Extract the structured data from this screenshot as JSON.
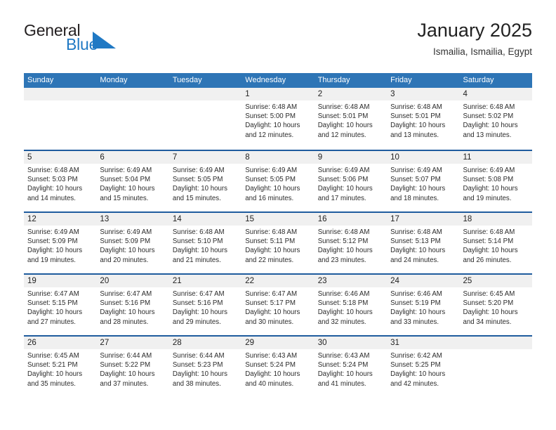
{
  "brand": {
    "name_part1": "General",
    "name_part2": "Blue",
    "triangle_icon": "blue-triangle-icon",
    "color_dark": "#231f20",
    "color_blue": "#2079c4"
  },
  "header": {
    "title": "January 2025",
    "subtitle": "Ismailia, Ismailia, Egypt"
  },
  "theme": {
    "header_row_bg": "#2e75b6",
    "week_separator": "#1f5c9e",
    "day_number_bg": "#f0f0f0",
    "text": "#2b2b2b"
  },
  "weekdays": [
    "Sunday",
    "Monday",
    "Tuesday",
    "Wednesday",
    "Thursday",
    "Friday",
    "Saturday"
  ],
  "weeks": [
    [
      {
        "empty": true,
        "day": ""
      },
      {
        "empty": true,
        "day": ""
      },
      {
        "empty": true,
        "day": ""
      },
      {
        "day": "1",
        "sunrise": "Sunrise: 6:48 AM",
        "sunset": "Sunset: 5:00 PM",
        "daylight": "Daylight: 10 hours and 12 minutes."
      },
      {
        "day": "2",
        "sunrise": "Sunrise: 6:48 AM",
        "sunset": "Sunset: 5:01 PM",
        "daylight": "Daylight: 10 hours and 12 minutes."
      },
      {
        "day": "3",
        "sunrise": "Sunrise: 6:48 AM",
        "sunset": "Sunset: 5:01 PM",
        "daylight": "Daylight: 10 hours and 13 minutes."
      },
      {
        "day": "4",
        "sunrise": "Sunrise: 6:48 AM",
        "sunset": "Sunset: 5:02 PM",
        "daylight": "Daylight: 10 hours and 13 minutes."
      }
    ],
    [
      {
        "day": "5",
        "sunrise": "Sunrise: 6:48 AM",
        "sunset": "Sunset: 5:03 PM",
        "daylight": "Daylight: 10 hours and 14 minutes."
      },
      {
        "day": "6",
        "sunrise": "Sunrise: 6:49 AM",
        "sunset": "Sunset: 5:04 PM",
        "daylight": "Daylight: 10 hours and 15 minutes."
      },
      {
        "day": "7",
        "sunrise": "Sunrise: 6:49 AM",
        "sunset": "Sunset: 5:05 PM",
        "daylight": "Daylight: 10 hours and 15 minutes."
      },
      {
        "day": "8",
        "sunrise": "Sunrise: 6:49 AM",
        "sunset": "Sunset: 5:05 PM",
        "daylight": "Daylight: 10 hours and 16 minutes."
      },
      {
        "day": "9",
        "sunrise": "Sunrise: 6:49 AM",
        "sunset": "Sunset: 5:06 PM",
        "daylight": "Daylight: 10 hours and 17 minutes."
      },
      {
        "day": "10",
        "sunrise": "Sunrise: 6:49 AM",
        "sunset": "Sunset: 5:07 PM",
        "daylight": "Daylight: 10 hours and 18 minutes."
      },
      {
        "day": "11",
        "sunrise": "Sunrise: 6:49 AM",
        "sunset": "Sunset: 5:08 PM",
        "daylight": "Daylight: 10 hours and 19 minutes."
      }
    ],
    [
      {
        "day": "12",
        "sunrise": "Sunrise: 6:49 AM",
        "sunset": "Sunset: 5:09 PM",
        "daylight": "Daylight: 10 hours and 19 minutes."
      },
      {
        "day": "13",
        "sunrise": "Sunrise: 6:49 AM",
        "sunset": "Sunset: 5:09 PM",
        "daylight": "Daylight: 10 hours and 20 minutes."
      },
      {
        "day": "14",
        "sunrise": "Sunrise: 6:48 AM",
        "sunset": "Sunset: 5:10 PM",
        "daylight": "Daylight: 10 hours and 21 minutes."
      },
      {
        "day": "15",
        "sunrise": "Sunrise: 6:48 AM",
        "sunset": "Sunset: 5:11 PM",
        "daylight": "Daylight: 10 hours and 22 minutes."
      },
      {
        "day": "16",
        "sunrise": "Sunrise: 6:48 AM",
        "sunset": "Sunset: 5:12 PM",
        "daylight": "Daylight: 10 hours and 23 minutes."
      },
      {
        "day": "17",
        "sunrise": "Sunrise: 6:48 AM",
        "sunset": "Sunset: 5:13 PM",
        "daylight": "Daylight: 10 hours and 24 minutes."
      },
      {
        "day": "18",
        "sunrise": "Sunrise: 6:48 AM",
        "sunset": "Sunset: 5:14 PM",
        "daylight": "Daylight: 10 hours and 26 minutes."
      }
    ],
    [
      {
        "day": "19",
        "sunrise": "Sunrise: 6:47 AM",
        "sunset": "Sunset: 5:15 PM",
        "daylight": "Daylight: 10 hours and 27 minutes."
      },
      {
        "day": "20",
        "sunrise": "Sunrise: 6:47 AM",
        "sunset": "Sunset: 5:16 PM",
        "daylight": "Daylight: 10 hours and 28 minutes."
      },
      {
        "day": "21",
        "sunrise": "Sunrise: 6:47 AM",
        "sunset": "Sunset: 5:16 PM",
        "daylight": "Daylight: 10 hours and 29 minutes."
      },
      {
        "day": "22",
        "sunrise": "Sunrise: 6:47 AM",
        "sunset": "Sunset: 5:17 PM",
        "daylight": "Daylight: 10 hours and 30 minutes."
      },
      {
        "day": "23",
        "sunrise": "Sunrise: 6:46 AM",
        "sunset": "Sunset: 5:18 PM",
        "daylight": "Daylight: 10 hours and 32 minutes."
      },
      {
        "day": "24",
        "sunrise": "Sunrise: 6:46 AM",
        "sunset": "Sunset: 5:19 PM",
        "daylight": "Daylight: 10 hours and 33 minutes."
      },
      {
        "day": "25",
        "sunrise": "Sunrise: 6:45 AM",
        "sunset": "Sunset: 5:20 PM",
        "daylight": "Daylight: 10 hours and 34 minutes."
      }
    ],
    [
      {
        "day": "26",
        "sunrise": "Sunrise: 6:45 AM",
        "sunset": "Sunset: 5:21 PM",
        "daylight": "Daylight: 10 hours and 35 minutes."
      },
      {
        "day": "27",
        "sunrise": "Sunrise: 6:44 AM",
        "sunset": "Sunset: 5:22 PM",
        "daylight": "Daylight: 10 hours and 37 minutes."
      },
      {
        "day": "28",
        "sunrise": "Sunrise: 6:44 AM",
        "sunset": "Sunset: 5:23 PM",
        "daylight": "Daylight: 10 hours and 38 minutes."
      },
      {
        "day": "29",
        "sunrise": "Sunrise: 6:43 AM",
        "sunset": "Sunset: 5:24 PM",
        "daylight": "Daylight: 10 hours and 40 minutes."
      },
      {
        "day": "30",
        "sunrise": "Sunrise: 6:43 AM",
        "sunset": "Sunset: 5:24 PM",
        "daylight": "Daylight: 10 hours and 41 minutes."
      },
      {
        "day": "31",
        "sunrise": "Sunrise: 6:42 AM",
        "sunset": "Sunset: 5:25 PM",
        "daylight": "Daylight: 10 hours and 42 minutes."
      },
      {
        "empty": true,
        "day": ""
      }
    ]
  ]
}
